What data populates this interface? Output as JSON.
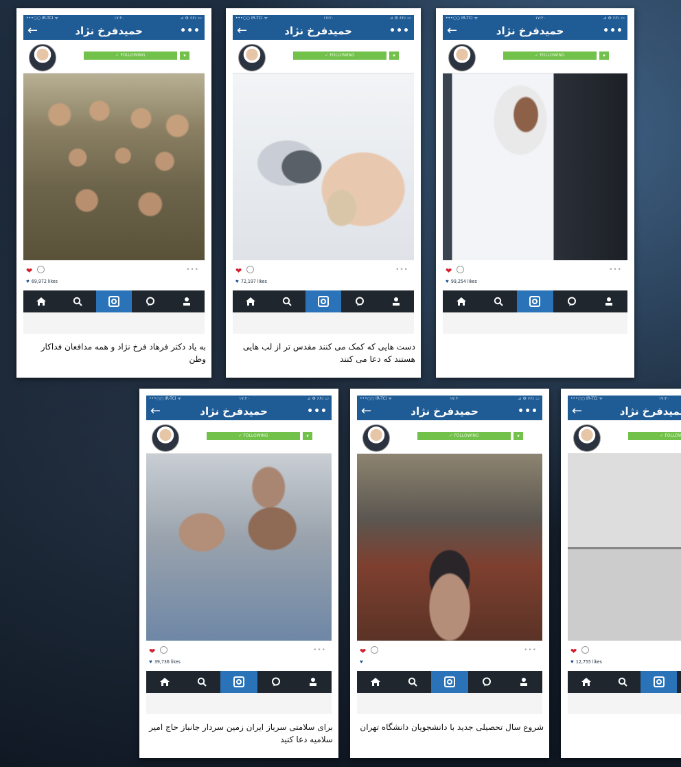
{
  "shared": {
    "status_carrier": "•••○○ IR-TCI ᯤ",
    "status_time": "۱۷:۲۰",
    "status_right": "⊿ ⚙ ۶۶٪ ▭",
    "profile_name": "حمیدفرخ نژاد",
    "follow_label": "✓ FOLLOWING",
    "follow_drop": "▾",
    "back_glyph": "←",
    "more_glyph": "•••",
    "icons": [
      "home-icon",
      "search-icon",
      "camera-icon",
      "activity-icon",
      "profile-icon"
    ]
  },
  "posts": [
    {
      "likes": "69,972 likes",
      "caption": "به یاد دکتر فرهاد فرخ نژاد و همه مدافعان فداکار وطن"
    },
    {
      "likes": "72,197 likes",
      "caption": "دست هایی که کمک می کنند مقدس تر از لب هایی هستند که دعا می کنند"
    },
    {
      "likes": "99,254 likes",
      "caption": ""
    },
    {
      "likes": "39,736 likes",
      "caption": "برای سلامتی سرباز ایران زمین سردار جانباز حاج امیر سلامیه دعا کنید"
    },
    {
      "likes": "",
      "caption": "شروع سال تحصیلی جدید با دانشجویان دانشگاه تهران"
    },
    {
      "likes": "12,755 likes",
      "caption": ""
    }
  ]
}
